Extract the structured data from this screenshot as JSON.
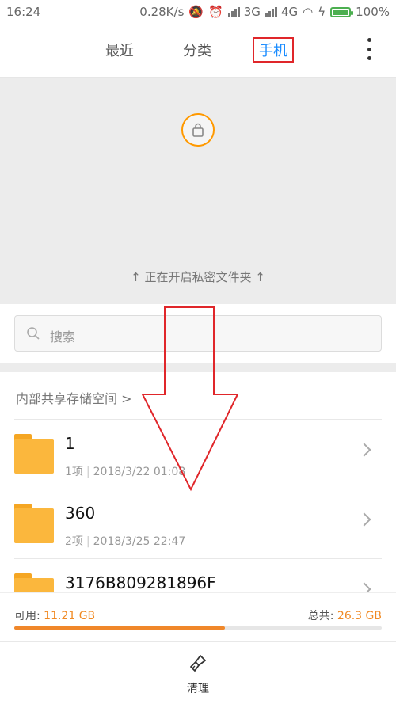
{
  "status_bar": {
    "time": "16:24",
    "net_speed": "0.28K/s",
    "net3g": "3G",
    "net4g": "4G",
    "battery": "100%",
    "battery_level": 1.0
  },
  "tabs": [
    {
      "label": "最近",
      "active": false
    },
    {
      "label": "分类",
      "active": false
    },
    {
      "label": "手机",
      "active": true
    }
  ],
  "private_folder": {
    "hint": "↑ 正在开启私密文件夹 ↑",
    "icon": "lock-icon"
  },
  "search": {
    "placeholder": "搜索"
  },
  "breadcrumb": "内部共享存储空间 >",
  "files": [
    {
      "name": "1",
      "count": "1项",
      "date": "2018/3/22 01:08"
    },
    {
      "name": "360",
      "count": "2项",
      "date": "2018/3/25 22:47"
    },
    {
      "name": "3176B809281896F",
      "count": "",
      "date": ""
    }
  ],
  "storage": {
    "available_label": "可用:",
    "available_value": "11.21 GB",
    "total_label": "总共:",
    "total_value": "26.3 GB",
    "used_fraction": 0.574
  },
  "bottom_bar": {
    "clean_label": "清理"
  },
  "colors": {
    "accent": "#1a8cff",
    "orange": "#f0872a",
    "annotation_red": "#e0262a",
    "folder": "#fbb73d"
  }
}
